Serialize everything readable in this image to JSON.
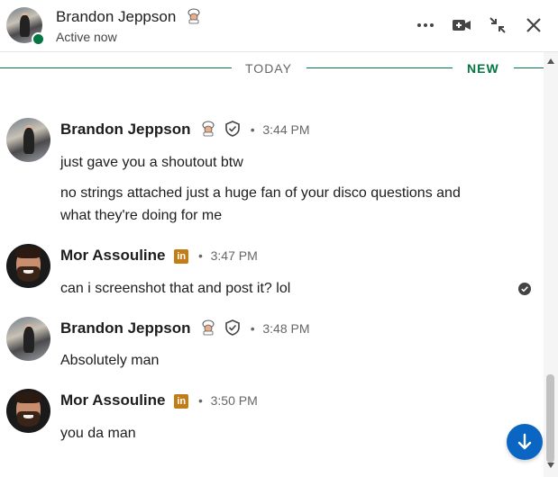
{
  "header": {
    "name": "Brandon Jeppson",
    "status": "Active now",
    "icons": [
      "more-options-icon",
      "video-call-icon",
      "minimize-icon",
      "close-icon"
    ]
  },
  "dividers": {
    "today": "TODAY",
    "new": "NEW"
  },
  "messages": [
    {
      "sender": "Brandon Jeppson",
      "time": "3:44 PM",
      "lines": [
        "just gave you a shoutout btw",
        "no strings attached just a huge fan of your disco questions and what they're doing for me"
      ]
    },
    {
      "sender": "Mor Assouline",
      "time": "3:47 PM",
      "lines": [
        "can i screenshot that and post it? lol"
      ]
    },
    {
      "sender": "Brandon Jeppson",
      "time": "3:48 PM",
      "lines": [
        "Absolutely man"
      ]
    },
    {
      "sender": "Mor Assouline",
      "time": "3:50 PM",
      "lines": [
        "you da man"
      ]
    }
  ],
  "badges": {
    "linkedin": "in",
    "separator": "•"
  },
  "colors": {
    "accent_green": "#057642",
    "linkedin_blue": "#0a66c2",
    "premium_gold": "#c37d16"
  }
}
